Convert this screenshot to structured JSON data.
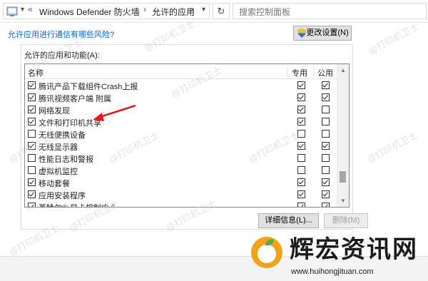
{
  "address_bar": {
    "back_chevron": "«",
    "breadcrumb": [
      "Windows Defender 防火墙",
      "允许的应用"
    ],
    "separator": "›",
    "dropdown_icon": "chevron-down-icon",
    "refresh_icon": "refresh-icon",
    "search_placeholder": "搜索控制面板"
  },
  "risk_link": "允许应用进行通信有哪些风险?",
  "change_settings_button": "更改设置(N)",
  "group": {
    "title": "允许的应用和功能(A):",
    "columns": {
      "name": "名称",
      "private": "专用",
      "public": "公用"
    },
    "rows": [
      {
        "label": "腾讯产品下载组件Crash上报",
        "enabled": true,
        "private": true,
        "public": true
      },
      {
        "label": "腾讯视频客户端 附属",
        "enabled": true,
        "private": true,
        "public": true
      },
      {
        "label": "网络发现",
        "enabled": true,
        "private": true,
        "public": false
      },
      {
        "label": "文件和打印机共享",
        "enabled": true,
        "private": true,
        "public": false
      },
      {
        "label": "无线便携设备",
        "enabled": false,
        "private": false,
        "public": false
      },
      {
        "label": "无线显示器",
        "enabled": true,
        "private": true,
        "public": true
      },
      {
        "label": "性能日志和警报",
        "enabled": false,
        "private": false,
        "public": false
      },
      {
        "label": "虚拟机监控",
        "enabled": false,
        "private": false,
        "public": false
      },
      {
        "label": "移动套餐",
        "enabled": true,
        "private": true,
        "public": true
      },
      {
        "label": "应用安装程序",
        "enabled": true,
        "private": true,
        "public": true
      },
      {
        "label": "英特尔® 显卡控制中心",
        "enabled": true,
        "private": true,
        "public": true
      }
    ],
    "details_button": "详细信息(L)...",
    "delete_button": "删除(M)"
  },
  "watermark_text": "@打印机卫士",
  "logo": {
    "title": "辉宏资讯网",
    "url": "www.huihongjituan.com"
  },
  "colors": {
    "link": "#0a64c8",
    "arrow": "#e11b1b",
    "logo_orange": "#f4a11a",
    "logo_green": "#52b043"
  }
}
